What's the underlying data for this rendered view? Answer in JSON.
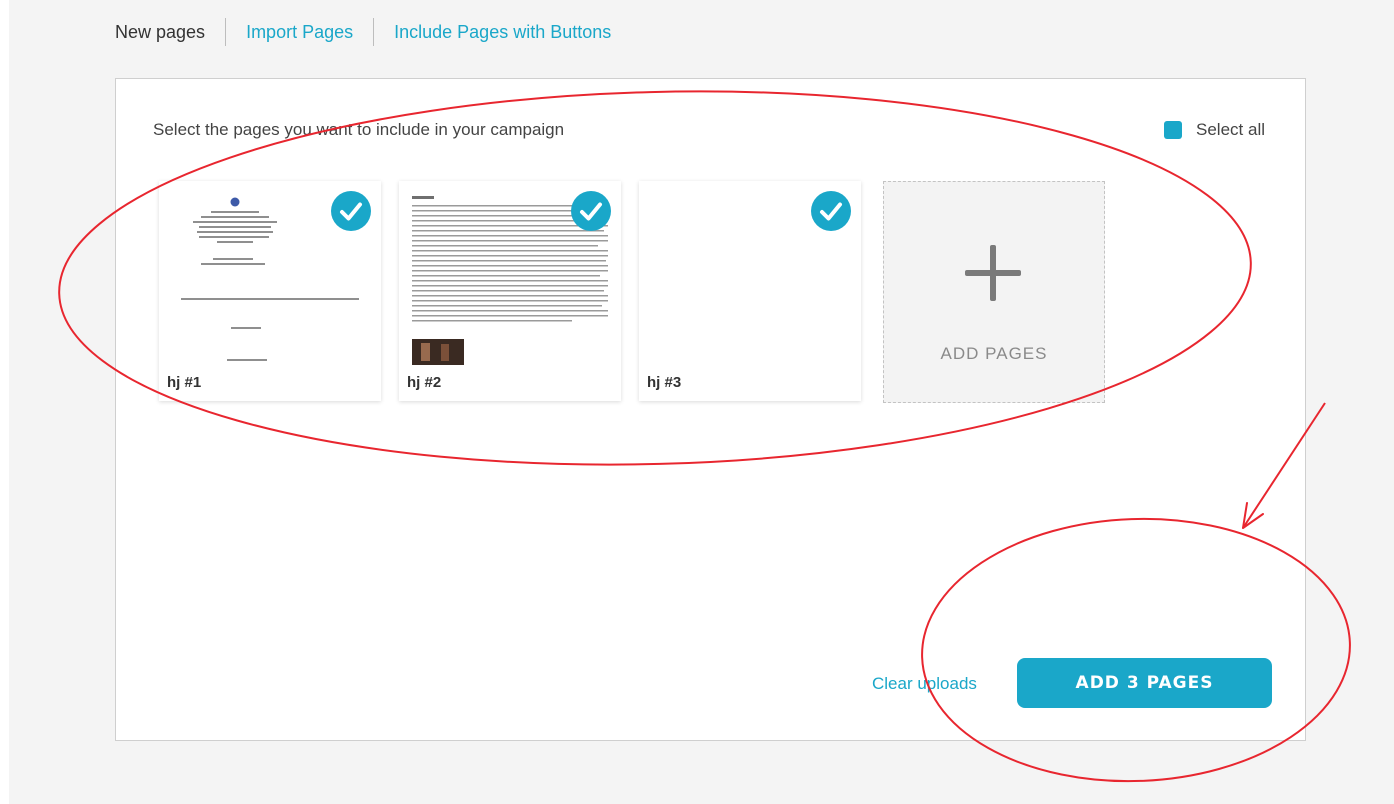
{
  "tabs": [
    {
      "label": "New pages"
    },
    {
      "label": "Import Pages"
    },
    {
      "label": "Include Pages with Buttons"
    }
  ],
  "panel": {
    "prompt": "Select the pages you want to include in your campaign",
    "select_all_label": "Select all"
  },
  "pages": [
    {
      "label": "hj #1",
      "checked": true
    },
    {
      "label": "hj #2",
      "checked": true
    },
    {
      "label": "hj #3",
      "checked": true
    }
  ],
  "add_pages_label": "ADD PAGES",
  "footer": {
    "clear_label": "Clear uploads",
    "add_button_label": "ADD 3 PAGES"
  },
  "colors": {
    "accent": "#1aa7c9",
    "annotation": "#e8262f",
    "background": "#f4f4f4"
  },
  "icons": [
    "checkmark-icon",
    "plus-icon",
    "emblem-icon"
  ]
}
